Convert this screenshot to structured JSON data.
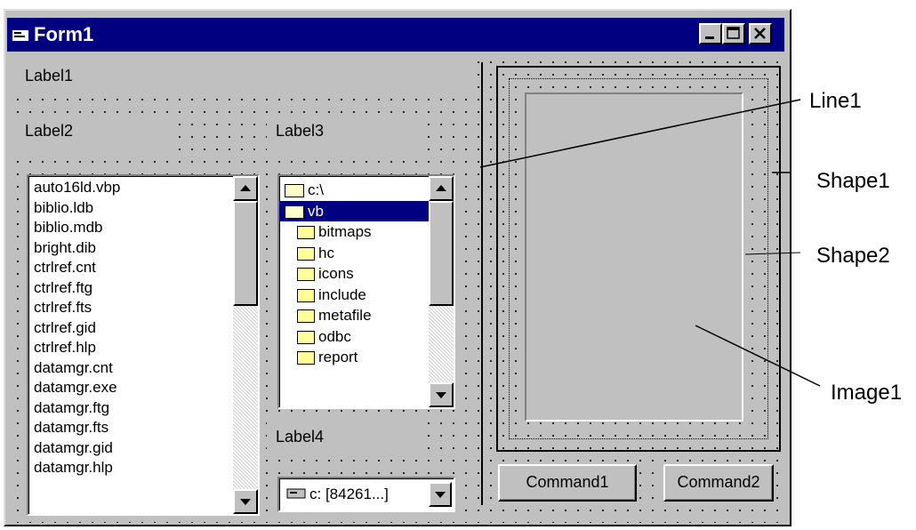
{
  "window": {
    "title": "Form1",
    "icon": "form-icon",
    "caption_buttons": [
      "minimize-icon",
      "maximize-icon",
      "close-icon"
    ]
  },
  "labels": {
    "label1": "Label1",
    "label2": "Label2",
    "label3": "Label3",
    "label4": "Label4"
  },
  "file_list": {
    "items": [
      "auto16ld.vbp",
      "biblio.ldb",
      "biblio.mdb",
      "bright.dib",
      "ctrlref.cnt",
      "ctrlref.ftg",
      "ctrlref.fts",
      "ctrlref.gid",
      "ctrlref.hlp",
      "datamgr.cnt",
      "datamgr.exe",
      "datamgr.ftg",
      "datamgr.fts",
      "datamgr.gid",
      "datamgr.hlp"
    ]
  },
  "dir_list": {
    "items": [
      {
        "label": "c:\\",
        "icon": "open-folder-icon",
        "selected": false
      },
      {
        "label": "vb",
        "icon": "open-folder-icon",
        "selected": true
      },
      {
        "label": "bitmaps",
        "icon": "folder-icon",
        "selected": false
      },
      {
        "label": "hc",
        "icon": "folder-icon",
        "selected": false
      },
      {
        "label": "icons",
        "icon": "folder-icon",
        "selected": false
      },
      {
        "label": "include",
        "icon": "folder-icon",
        "selected": false
      },
      {
        "label": "metafile",
        "icon": "folder-icon",
        "selected": false
      },
      {
        "label": "odbc",
        "icon": "folder-icon",
        "selected": false
      },
      {
        "label": "report",
        "icon": "folder-icon",
        "selected": false
      }
    ]
  },
  "drive_list": {
    "value": "c: [84261...]",
    "icon": "drive-icon"
  },
  "buttons": {
    "command1": "Command1",
    "command2": "Command2"
  },
  "callouts": {
    "line1": "Line1",
    "shape1": "Shape1",
    "shape2": "Shape2",
    "image1": "Image1"
  },
  "colors": {
    "title_bar": "#000080",
    "selection": "#000080",
    "face": "#c0c0c0"
  }
}
